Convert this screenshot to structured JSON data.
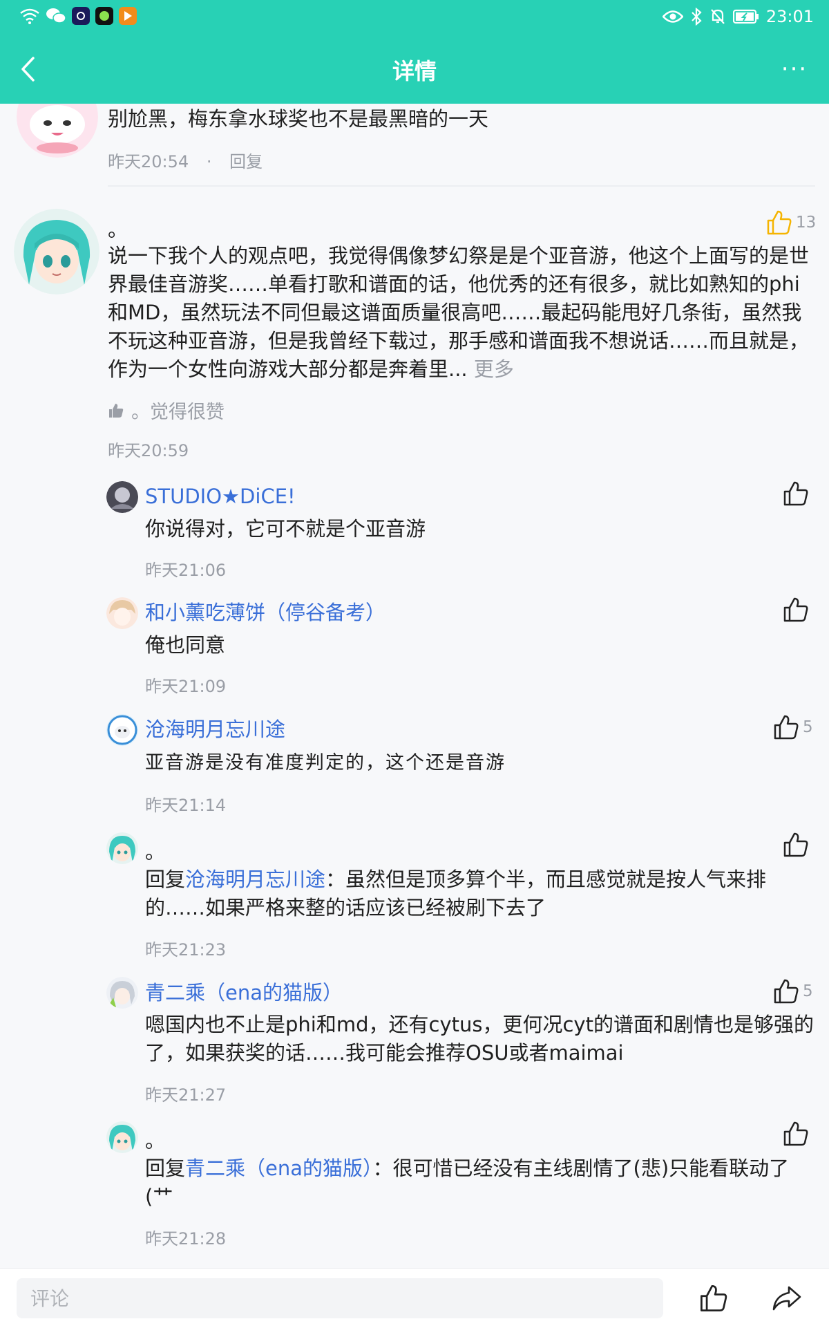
{
  "status_bar": {
    "time": "23:01",
    "icons": [
      "wifi-icon",
      "wechat-icon",
      "app-icon",
      "app-icon",
      "app-icon",
      "eye-icon",
      "bluetooth-icon",
      "mute-icon",
      "battery-icon"
    ]
  },
  "header": {
    "title": "详情",
    "back_icon": "chevron-left-icon",
    "more_label": "···"
  },
  "colors": {
    "accent": "#28d1b5",
    "link": "#3a6fd8",
    "meta": "#9a9ea6",
    "like_active": "#f5b400"
  },
  "prev_comment": {
    "text": "别尬黑，梅东拿水球奖也不是最黑暗的一天",
    "time": "昨天20:54",
    "separator": "·",
    "reply_label": "回复"
  },
  "main_comment": {
    "user": "。",
    "likes": "13",
    "text": "说一下我个人的观点吧，我觉得偶像梦幻祭是是个亚音游，他这个上面写的是世界最佳音游奖……单看打歌和谱面的话，他优秀的还有很多，就比如熟知的phi和MD，虽然玩法不同但最这谱面质量很高吧……最起码能甩好几条街，虽然我不玩这种亚音游，但是我曾经下载过，那手感和谱面我不想说话……而且就是，作为一个女性向游戏大部分都是奔着里...",
    "more_label": "更多",
    "liked_by": "。觉得很赞",
    "time": "昨天20:59"
  },
  "replies": [
    {
      "user": "STUDIO★DiCE!",
      "text": "你说得对，它可不就是个亚音游",
      "time": "昨天21:06",
      "likes": ""
    },
    {
      "user": "和小薰吃薄饼（停谷备考）",
      "text": "俺也同意",
      "time": "昨天21:09",
      "likes": ""
    },
    {
      "user": "沧海明月忘川途",
      "text": "亚音游是没有准度判定的，这个还是音游",
      "time": "昨天21:14",
      "likes": "5"
    },
    {
      "user": "。",
      "reply_prefix": "回复",
      "mention": "沧海明月忘川途",
      "text": "：虽然但是顶多算个半，而且感觉就是按人气来排的……如果严格来整的话应该已经被刷下去了",
      "time": "昨天21:23",
      "likes": ""
    },
    {
      "user": "青二乘（ena的猫版）",
      "text": "嗯国内也不止是phi和md，还有cytus，更何况cyt的谱面和剧情也是够强的了，如果获奖的话……我可能会推荐OSU或者maimai",
      "time": "昨天21:27",
      "likes": "5"
    },
    {
      "user": "。",
      "reply_prefix": "回复",
      "mention": "青二乘（ena的猫版）",
      "text": "：很可惜已经没有主线剧情了(悲)只能看联动了(艹",
      "time": "昨天21:28",
      "likes": ""
    }
  ],
  "bottom_bar": {
    "comment_placeholder": "评论"
  }
}
